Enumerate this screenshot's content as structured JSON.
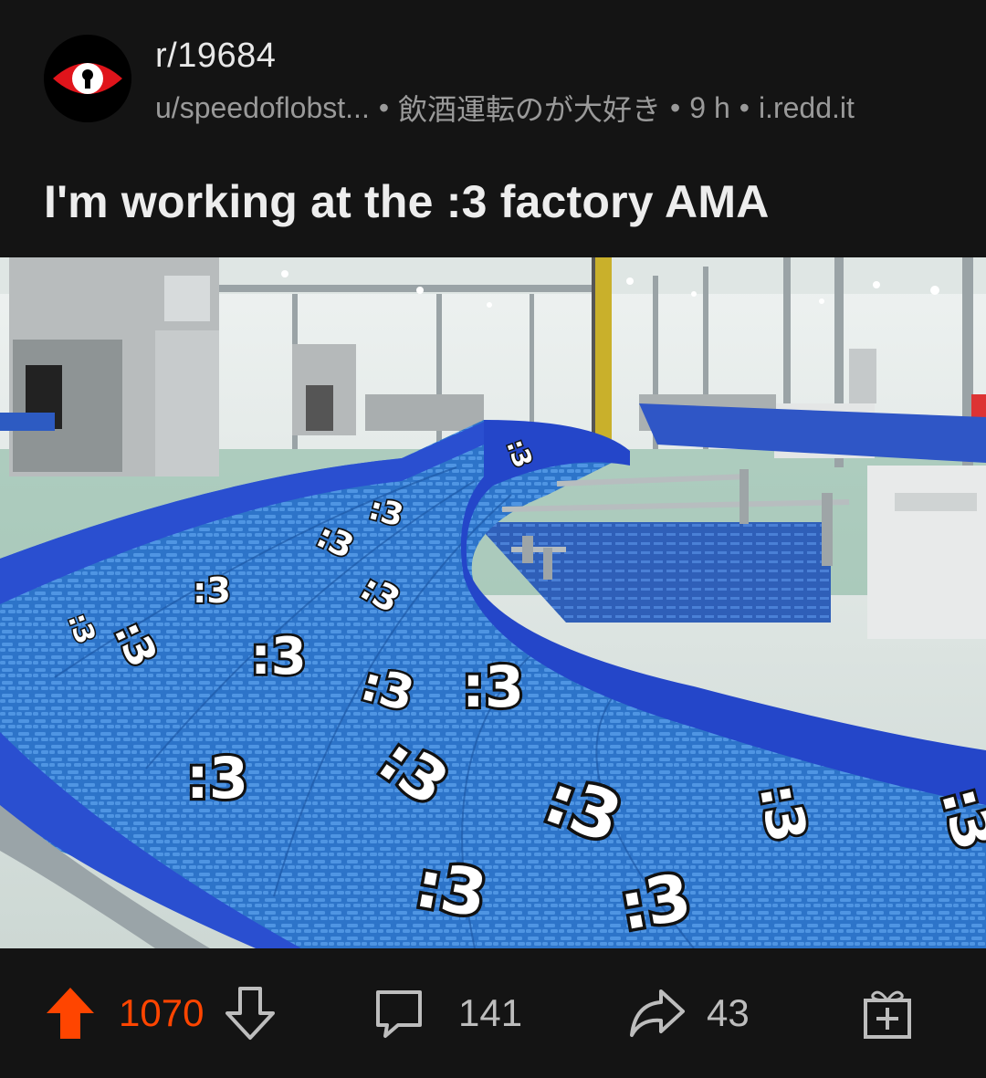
{
  "post": {
    "subreddit": "r/19684",
    "author": "u/speedoflobst...",
    "flair": "飲酒運転のが大好き",
    "age": "9 h",
    "domain": "i.redd.it",
    "separator": "•",
    "title": "I'm working at the :3 factory AMA"
  },
  "image": {
    "sticker_text": ":3",
    "stickers": [
      ":3",
      ":3",
      ":3",
      ":3",
      ":3",
      ":3",
      ":3",
      ":3",
      ":3",
      ":3",
      ":3",
      ":3",
      ":3",
      ":3",
      ":3",
      ":3",
      ":3"
    ]
  },
  "actions": {
    "upvotes": "1070",
    "comments": "141",
    "shares": "43"
  },
  "colors": {
    "background": "#141414",
    "upvote_active": "#ff4500",
    "conveyor_blue": "#1f4fd0",
    "avatar_red": "#e0141b"
  },
  "icons": [
    "subreddit-avatar-eye-icon",
    "upvote-icon",
    "downvote-icon",
    "comment-icon",
    "share-icon",
    "award-icon"
  ]
}
